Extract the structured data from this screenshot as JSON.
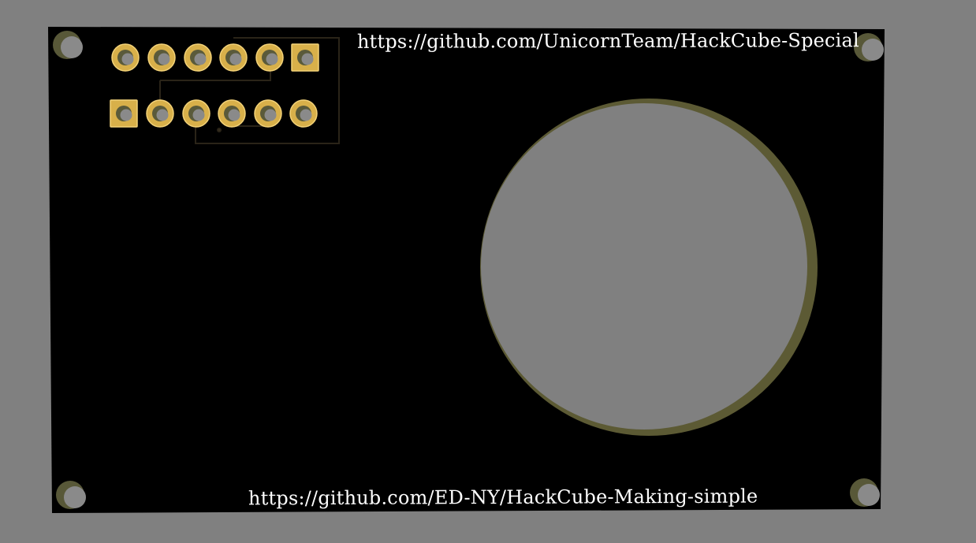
{
  "board": {
    "top_url": "https://github.com/UnicornTeam/HackCube-Special",
    "bottom_url": "https://github.com/ED-NY/HackCube-Making-simple"
  },
  "colors": {
    "background": "#808080",
    "board": "#000000",
    "pad_gold": "#d8b04a",
    "pad_rim": "#f3d278",
    "hole_fill": "#5a5a3a",
    "hole_shadow": "#585838",
    "trace": "#2a2418",
    "cutout_edge": "#5c5a34",
    "silkscreen": "#ffffff"
  },
  "header": {
    "rows": 2,
    "pins_per_row": 6
  },
  "icons": {
    "mounting_hole": "mounting-hole-icon",
    "pad": "through-hole-pad-icon",
    "cutout": "circular-cutout-icon"
  }
}
